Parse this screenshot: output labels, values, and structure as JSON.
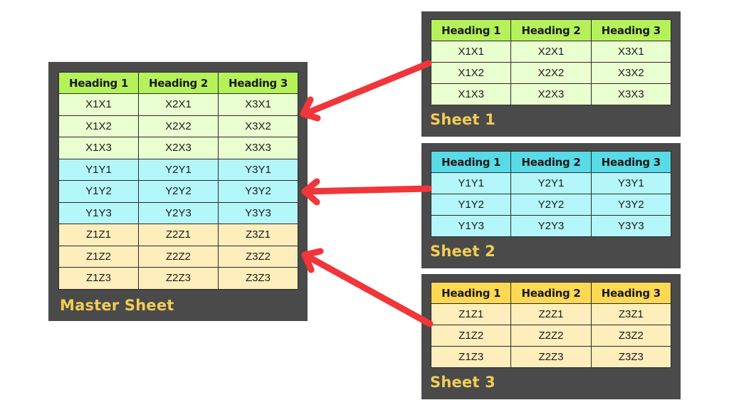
{
  "headings": [
    "Heading 1",
    "Heading 2",
    "Heading 3"
  ],
  "master": {
    "label": "Master Sheet",
    "rows": [
      {
        "group": "x",
        "cells": [
          "X1X1",
          "X2X1",
          "X3X1"
        ]
      },
      {
        "group": "x",
        "cells": [
          "X1X2",
          "X2X2",
          "X3X2"
        ]
      },
      {
        "group": "x",
        "cells": [
          "X1X3",
          "X2X3",
          "X3X3"
        ]
      },
      {
        "group": "y",
        "cells": [
          "Y1Y1",
          "Y2Y1",
          "Y3Y1"
        ]
      },
      {
        "group": "y",
        "cells": [
          "Y1Y2",
          "Y2Y2",
          "Y3Y2"
        ]
      },
      {
        "group": "y",
        "cells": [
          "Y1Y3",
          "Y2Y3",
          "Y3Y3"
        ]
      },
      {
        "group": "z",
        "cells": [
          "Z1Z1",
          "Z2Z1",
          "Z3Z1"
        ]
      },
      {
        "group": "z",
        "cells": [
          "Z1Z2",
          "Z2Z2",
          "Z3Z2"
        ]
      },
      {
        "group": "z",
        "cells": [
          "Z1Z3",
          "Z2Z3",
          "Z3Z3"
        ]
      }
    ]
  },
  "sheets": [
    {
      "label": "Sheet 1",
      "rows": [
        [
          "X1X1",
          "X2X1",
          "X3X1"
        ],
        [
          "X1X2",
          "X2X2",
          "X3X2"
        ],
        [
          "X1X3",
          "X2X3",
          "X3X3"
        ]
      ]
    },
    {
      "label": "Sheet 2",
      "rows": [
        [
          "Y1Y1",
          "Y2Y1",
          "Y3Y1"
        ],
        [
          "Y1Y2",
          "Y2Y2",
          "Y3Y2"
        ],
        [
          "Y1Y3",
          "Y2Y3",
          "Y3Y3"
        ]
      ]
    },
    {
      "label": "Sheet 3",
      "rows": [
        [
          "Z1Z1",
          "Z2Z1",
          "Z3Z1"
        ],
        [
          "Z1Z2",
          "Z2Z2",
          "Z3Z2"
        ],
        [
          "Z1Z3",
          "Z2Z3",
          "Z3Z3"
        ]
      ]
    }
  ],
  "arrows": [
    {
      "from": "Sheet 1",
      "to": "Master Sheet"
    },
    {
      "from": "Sheet 2",
      "to": "Master Sheet"
    },
    {
      "from": "Sheet 3",
      "to": "Master Sheet"
    }
  ],
  "colors": {
    "panel_bg": "#4a4a4a",
    "label_text": "#f2cd55",
    "arrow": "#f0363a",
    "x_header": "#b5f25a",
    "x_cell": "#eaffd0",
    "y_header": "#58dbe6",
    "y_cell": "#b4f7fb",
    "z_header": "#fdd853",
    "z_cell": "#fdeebb"
  }
}
